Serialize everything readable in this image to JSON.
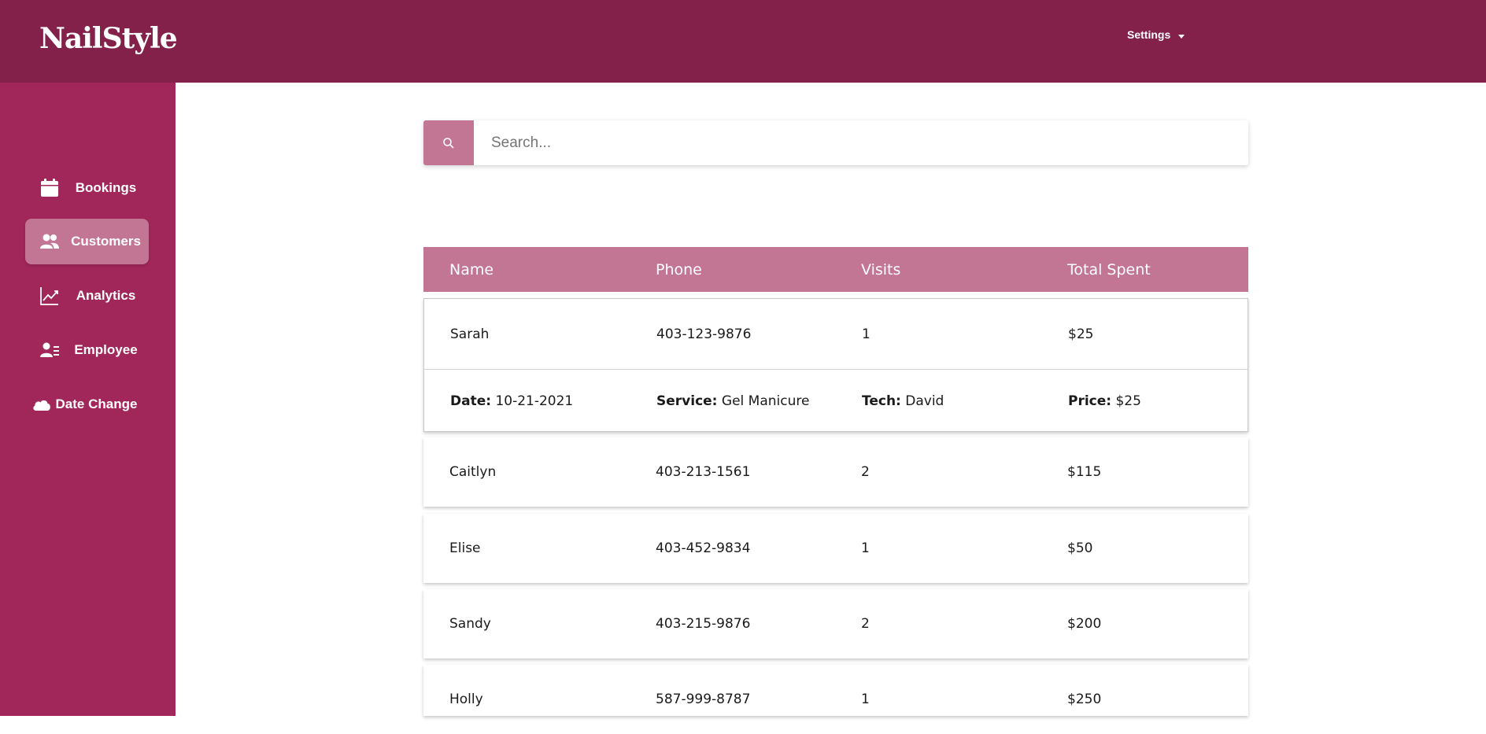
{
  "app": {
    "logo": "NailStyle"
  },
  "header": {
    "settings_label": "Settings"
  },
  "sidebar": {
    "items": [
      {
        "label": "Bookings"
      },
      {
        "label": "Customers",
        "active": true
      },
      {
        "label": "Analytics"
      },
      {
        "label": "Employee"
      },
      {
        "label": "Date Change"
      }
    ]
  },
  "search": {
    "placeholder": "Search..."
  },
  "table": {
    "columns": [
      "Name",
      "Phone",
      "Visits",
      "Total Spent"
    ],
    "rows": [
      {
        "name": "Sarah",
        "phone": "403-123-9876",
        "visits": "1",
        "total": "$25"
      },
      {
        "name": "Caitlyn",
        "phone": "403-213-1561",
        "visits": "2",
        "total": "$115"
      },
      {
        "name": "Elise",
        "phone": "403-452-9834",
        "visits": "1",
        "total": "$50"
      },
      {
        "name": "Sandy",
        "phone": "403-215-9876",
        "visits": "2",
        "total": "$200"
      },
      {
        "name": "Holly",
        "phone": "587-999-8787",
        "visits": "1",
        "total": "$250"
      }
    ],
    "expanded_detail": {
      "date_label": "Date:",
      "date": "10-21-2021",
      "service_label": "Service:",
      "service": "Gel Manicure",
      "tech_label": "Tech:",
      "tech": "David",
      "price_label": "Price:",
      "price": "$25"
    }
  },
  "colors": {
    "header": "#83214b",
    "sidebar": "#a1275a",
    "accent": "#c27693"
  }
}
